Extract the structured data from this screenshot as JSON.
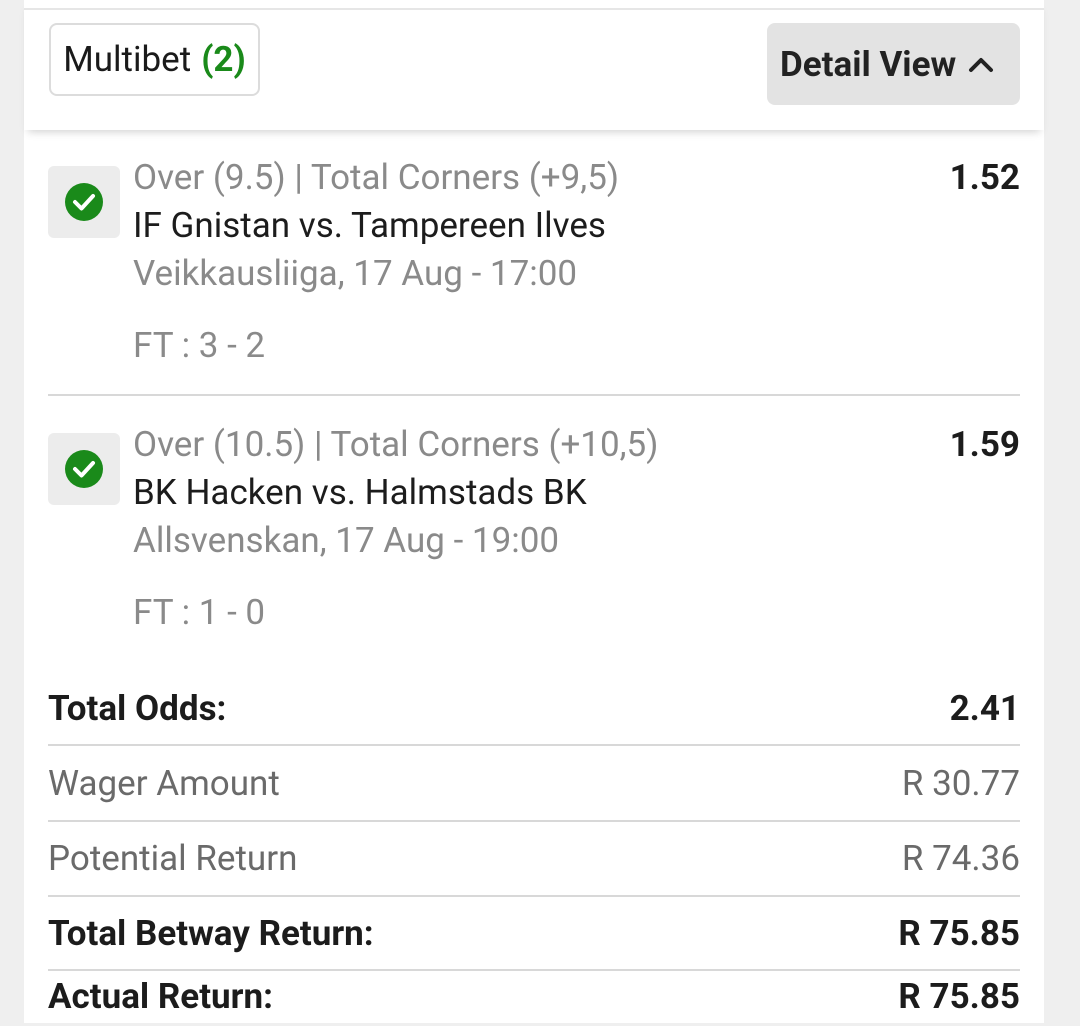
{
  "header": {
    "multibet_label": "Multibet",
    "multibet_count": "(2)",
    "detail_view_label": "Detail View"
  },
  "bets": [
    {
      "market": "Over (9.5) | Total Corners (+9,5)",
      "match": "IF Gnistan vs. Tampereen Ilves",
      "league_time": "Veikkausliiga, 17 Aug - 17:00",
      "result": "FT : 3 - 2",
      "odds": "1.52",
      "status_icon": "check-circle-icon"
    },
    {
      "market": "Over (10.5) | Total Corners (+10,5)",
      "match": "BK Hacken vs. Halmstads BK",
      "league_time": "Allsvenskan, 17 Aug - 19:00",
      "result": "FT : 1 - 0",
      "odds": "1.59",
      "status_icon": "check-circle-icon"
    }
  ],
  "summary": {
    "total_odds_label": "Total Odds:",
    "total_odds_value": "2.41",
    "wager_label": "Wager Amount",
    "wager_value": "R 30.77",
    "potential_label": "Potential Return",
    "potential_value": "R 74.36",
    "betway_return_label": "Total Betway Return:",
    "betway_return_value": "R 75.85",
    "actual_return_label": "Actual Return:",
    "actual_return_value": "R 75.85"
  },
  "colors": {
    "win_green": "#1a8a1a",
    "background": "#efefef",
    "card": "#ffffff"
  }
}
